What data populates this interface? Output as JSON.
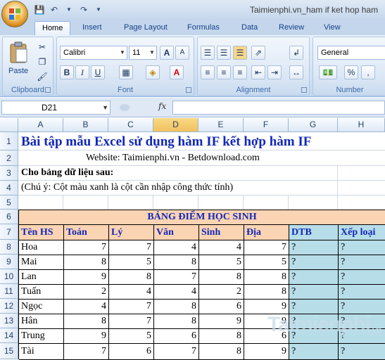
{
  "window": {
    "title": "Taimienphi.vn_ham if ket hop ham"
  },
  "ribbon_tabs": [
    "Home",
    "Insert",
    "Page Layout",
    "Formulas",
    "Data",
    "Review",
    "View"
  ],
  "groups": {
    "clipboard": "Clipboard",
    "font": "Font",
    "alignment": "Alignment",
    "number": "Number"
  },
  "clipboard": {
    "paste_label": "Paste"
  },
  "font": {
    "name": "Calibri",
    "size": "11",
    "bold": "B",
    "italic": "I",
    "underline": "U",
    "grow": "A",
    "shrink": "A"
  },
  "number": {
    "format": "General",
    "percent": "%"
  },
  "formula_bar": {
    "cell_ref": "D21",
    "fx": "fx",
    "value": ""
  },
  "columns": [
    "A",
    "B",
    "C",
    "D",
    "E",
    "F",
    "G",
    "H"
  ],
  "selected_column": "D",
  "rows": [
    "1",
    "2",
    "3",
    "4",
    "5",
    "6",
    "7",
    "8",
    "9",
    "10",
    "11",
    "12",
    "13",
    "14",
    "15"
  ],
  "sheet": {
    "title": "Bài tập mẫu Excel sử dụng hàm IF kết hợp hàm IF",
    "website": "Website: Taimienphi.vn - Betdownload.com",
    "intro": "Cho bảng dữ liệu sau:",
    "note": "(Chú ý: Cột màu xanh là cột cần nhập công thức tính)",
    "table_title": "BẢNG ĐIỂM HỌC SINH",
    "headers": [
      "Tên HS",
      "Toán",
      "Lý",
      "Văn",
      "Sinh",
      "Địa",
      "DTB",
      "Xếp loại"
    ],
    "students": [
      [
        "Hoa",
        "7",
        "7",
        "4",
        "4",
        "7",
        "?",
        "?"
      ],
      [
        "Mai",
        "8",
        "5",
        "8",
        "5",
        "5",
        "?",
        "?"
      ],
      [
        "Lan",
        "9",
        "8",
        "7",
        "8",
        "8",
        "?",
        "?"
      ],
      [
        "Tuấn",
        "2",
        "4",
        "4",
        "2",
        "8",
        "?",
        "?"
      ],
      [
        "Ngọc",
        "4",
        "7",
        "8",
        "6",
        "9",
        "?",
        "?"
      ],
      [
        "Hân",
        "8",
        "7",
        "8",
        "9",
        "9",
        "?",
        "?"
      ],
      [
        "Trung",
        "9",
        "5",
        "6",
        "8",
        "6",
        "?",
        "?"
      ],
      [
        "Tài",
        "7",
        "6",
        "7",
        "8",
        "9",
        "?",
        "?"
      ]
    ]
  },
  "colors": {
    "table_header_bg": "#fbd4b4",
    "formula_cols_bg": "#b7dde8",
    "header_text": "#1228b8"
  },
  "watermark": {
    "main": "Taimienphi",
    "tld": ".vn"
  }
}
